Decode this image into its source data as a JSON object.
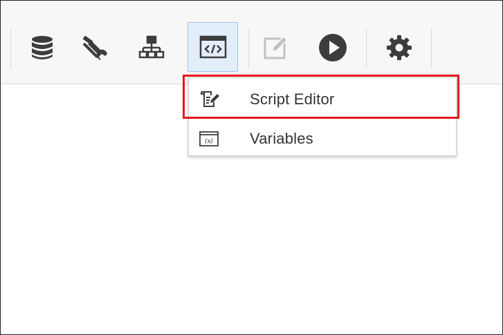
{
  "toolbar": {
    "buttons": [
      {
        "icon": "database-icon"
      },
      {
        "icon": "tools-icon"
      },
      {
        "icon": "hierarchy-icon"
      },
      {
        "icon": "script-icon",
        "active": true
      },
      {
        "icon": "edit-icon",
        "disabled": true
      },
      {
        "icon": "run-icon"
      },
      {
        "icon": "gear-icon"
      }
    ],
    "colors": {
      "icon": "#3c3c3c",
      "icon_disabled": "#c2c2c2",
      "active_bg": "#e3eefb",
      "active_border": "#9ec2ee",
      "highlight": "#e8141c"
    }
  },
  "menu": {
    "items": [
      {
        "label": "Script Editor",
        "icon": "script-editor-icon"
      },
      {
        "label": "Variables",
        "icon": "variables-icon",
        "icon_text": "(x)"
      }
    ]
  }
}
